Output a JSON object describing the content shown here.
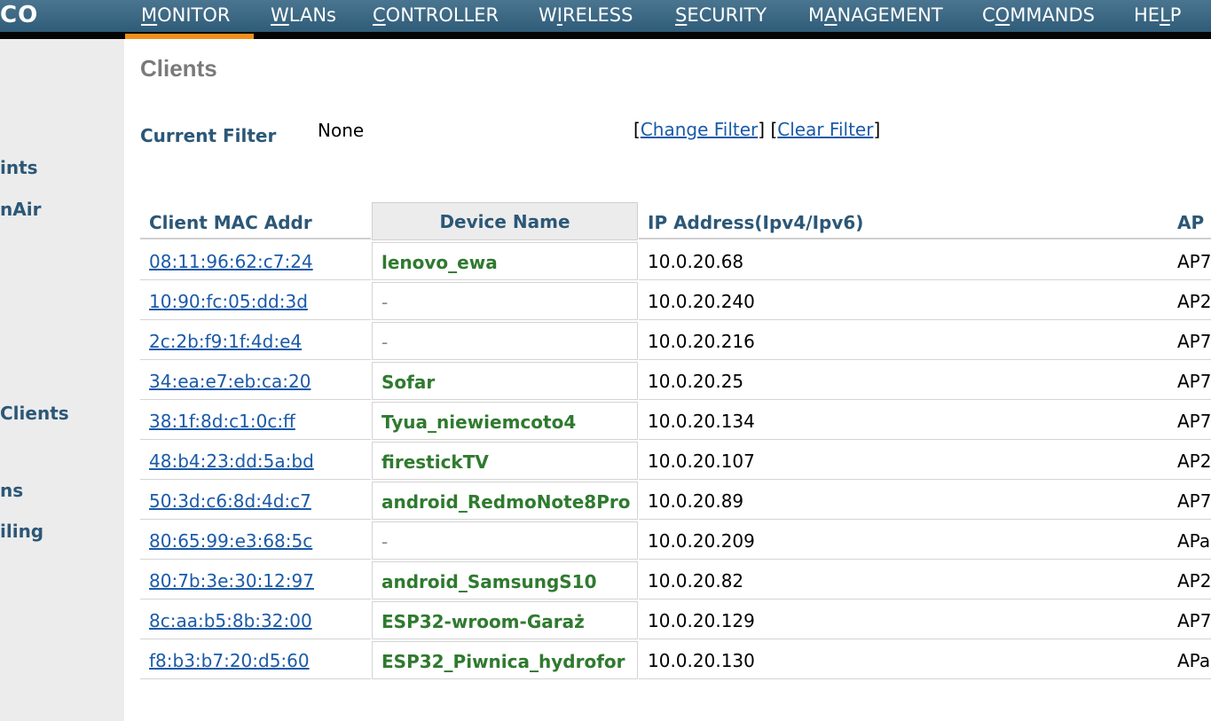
{
  "nav": {
    "logo": "CO",
    "items": [
      {
        "key": "M",
        "rest": "ONITOR",
        "pre": ""
      },
      {
        "key": "W",
        "rest": "LANs",
        "pre": ""
      },
      {
        "key": "C",
        "rest": "ONTROLLER",
        "pre": ""
      },
      {
        "key": "I",
        "rest": "RELESS",
        "pre": "W"
      },
      {
        "key": "S",
        "rest": "ECURITY",
        "pre": ""
      },
      {
        "key": "A",
        "rest": "NAGEMENT",
        "pre": "M"
      },
      {
        "key": "O",
        "rest": "MMANDS",
        "pre": "C"
      },
      {
        "key": "L",
        "rest": "P",
        "pre": "HE"
      }
    ]
  },
  "sidebar": {
    "items": [
      "ints",
      "nAir",
      "Clients",
      "ns",
      "iling"
    ]
  },
  "page": {
    "title": "Clients",
    "filter_label": "Current Filter",
    "filter_value": "None",
    "change_filter": "Change Filter",
    "clear_filter": "Clear Filter"
  },
  "table": {
    "headers": {
      "mac": "Client MAC Addr",
      "device": "Device Name",
      "ip": "IP Address(Ipv4/Ipv6)",
      "ap": "AP"
    },
    "rows": [
      {
        "mac": "08:11:96:62:c7:24",
        "device": "lenovo_ewa",
        "ip": "10.0.20.68",
        "ap": "AP7"
      },
      {
        "mac": "10:90:fc:05:dd:3d",
        "device": "-",
        "ip": "10.0.20.240",
        "ap": "AP2"
      },
      {
        "mac": "2c:2b:f9:1f:4d:e4",
        "device": "-",
        "ip": "10.0.20.216",
        "ap": "AP7"
      },
      {
        "mac": "34:ea:e7:eb:ca:20",
        "device": "Sofar",
        "ip": "10.0.20.25",
        "ap": "AP7"
      },
      {
        "mac": "38:1f:8d:c1:0c:ff",
        "device": "Tyua_niewiemcoto4",
        "ip": "10.0.20.134",
        "ap": "AP7"
      },
      {
        "mac": "48:b4:23:dd:5a:bd",
        "device": "firestickTV",
        "ip": "10.0.20.107",
        "ap": "AP2"
      },
      {
        "mac": "50:3d:c6:8d:4d:c7",
        "device": "android_RedmoNote8Pro",
        "ip": "10.0.20.89",
        "ap": "AP7"
      },
      {
        "mac": "80:65:99:e3:68:5c",
        "device": "-",
        "ip": "10.0.20.209",
        "ap": "APa"
      },
      {
        "mac": "80:7b:3e:30:12:97",
        "device": "android_SamsungS10",
        "ip": "10.0.20.82",
        "ap": "AP2"
      },
      {
        "mac": "8c:aa:b5:8b:32:00",
        "device": "ESP32-wroom-Garaż",
        "ip": "10.0.20.129",
        "ap": "AP7"
      },
      {
        "mac": "f8:b3:b7:20:d5:60",
        "device": "ESP32_Piwnica_hydrofor",
        "ip": "10.0.20.130",
        "ap": "APa"
      }
    ]
  },
  "colors": {
    "nav_bg": "#3a6784",
    "active_tab": "#f0901b",
    "header_text": "#2c5777",
    "link": "#1a5aa8",
    "device_name": "#2f7a2f"
  }
}
